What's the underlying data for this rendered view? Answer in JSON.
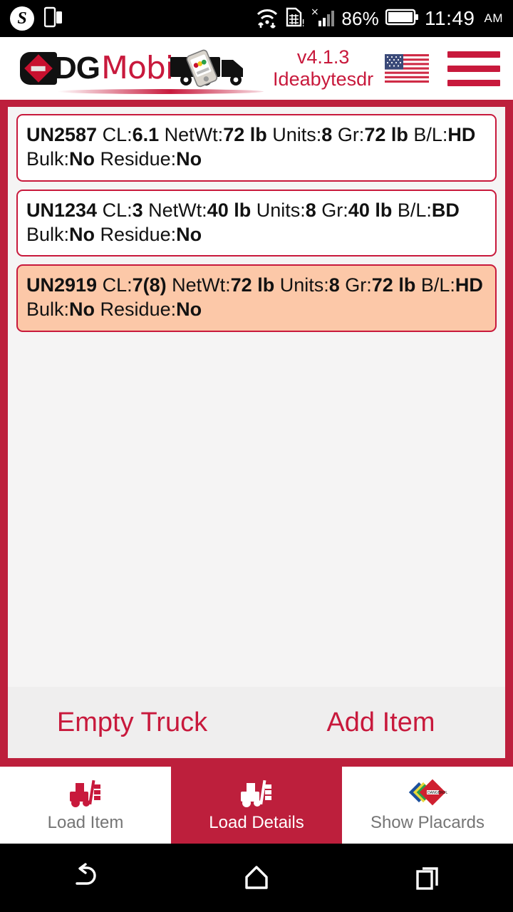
{
  "status_bar": {
    "skype_icon": "skype-icon",
    "cast_icon": "screen-cast-icon",
    "wifi_icon": "wifi-data-icon",
    "sim_icon": "sim-card-alert-icon",
    "signal_icon": "signal-no-service-icon",
    "battery_percent": "86%",
    "battery_icon": "battery-icon",
    "time": "11:49",
    "ampm": "AM"
  },
  "header": {
    "logo_dg": "DG",
    "logo_mobi": "Mobi",
    "truck_icon": "truck-icon",
    "version": "v4.1.3",
    "org": "Ideabytesdr",
    "flag_icon": "us-flag-icon",
    "menu_icon": "hamburger-menu-icon"
  },
  "items": [
    {
      "un": "UN2587",
      "cl_label": "CL:",
      "cl": "6.1",
      "netwt_label": "NetWt:",
      "netwt": "72 lb",
      "units_label": "Units:",
      "units": "8",
      "gr_label": "Gr:",
      "gr": "72 lb",
      "bl_label": "B/L:",
      "bl": "HD",
      "bulk_label": "Bulk:",
      "bulk": "No",
      "residue_label": "Residue:",
      "residue": "No",
      "selected": false
    },
    {
      "un": "UN1234",
      "cl_label": "CL:",
      "cl": "3",
      "netwt_label": "NetWt:",
      "netwt": "40 lb",
      "units_label": "Units:",
      "units": "8",
      "gr_label": "Gr:",
      "gr": "40 lb",
      "bl_label": "B/L:",
      "bl": "BD",
      "bulk_label": "Bulk:",
      "bulk": "No",
      "residue_label": "Residue:",
      "residue": "No",
      "selected": false
    },
    {
      "un": "UN2919",
      "cl_label": "CL:",
      "cl": "7(8)",
      "netwt_label": "NetWt:",
      "netwt": "72 lb",
      "units_label": "Units:",
      "units": "8",
      "gr_label": "Gr:",
      "gr": "72 lb",
      "bl_label": "B/L:",
      "bl": "HD",
      "bulk_label": "Bulk:",
      "bulk": "No",
      "residue_label": "Residue:",
      "residue": "No",
      "selected": true
    }
  ],
  "actions": {
    "empty_truck": "Empty Truck",
    "add_item": "Add Item"
  },
  "tabs": [
    {
      "label": "Load Item",
      "icon": "forklift-icon",
      "active": false
    },
    {
      "label": "Load Details",
      "icon": "forklift-icon",
      "active": true
    },
    {
      "label": "Show Placards",
      "icon": "placards-icon",
      "active": false
    }
  ],
  "nav_bar": {
    "back_icon": "back-icon",
    "home_icon": "home-icon",
    "recents_icon": "recent-apps-icon"
  },
  "colors": {
    "brand_crimson": "#c8193c",
    "frame_red": "#bd1f3c",
    "selected_peach": "#fcc8a8",
    "panel_gray": "#f5f4f4"
  }
}
